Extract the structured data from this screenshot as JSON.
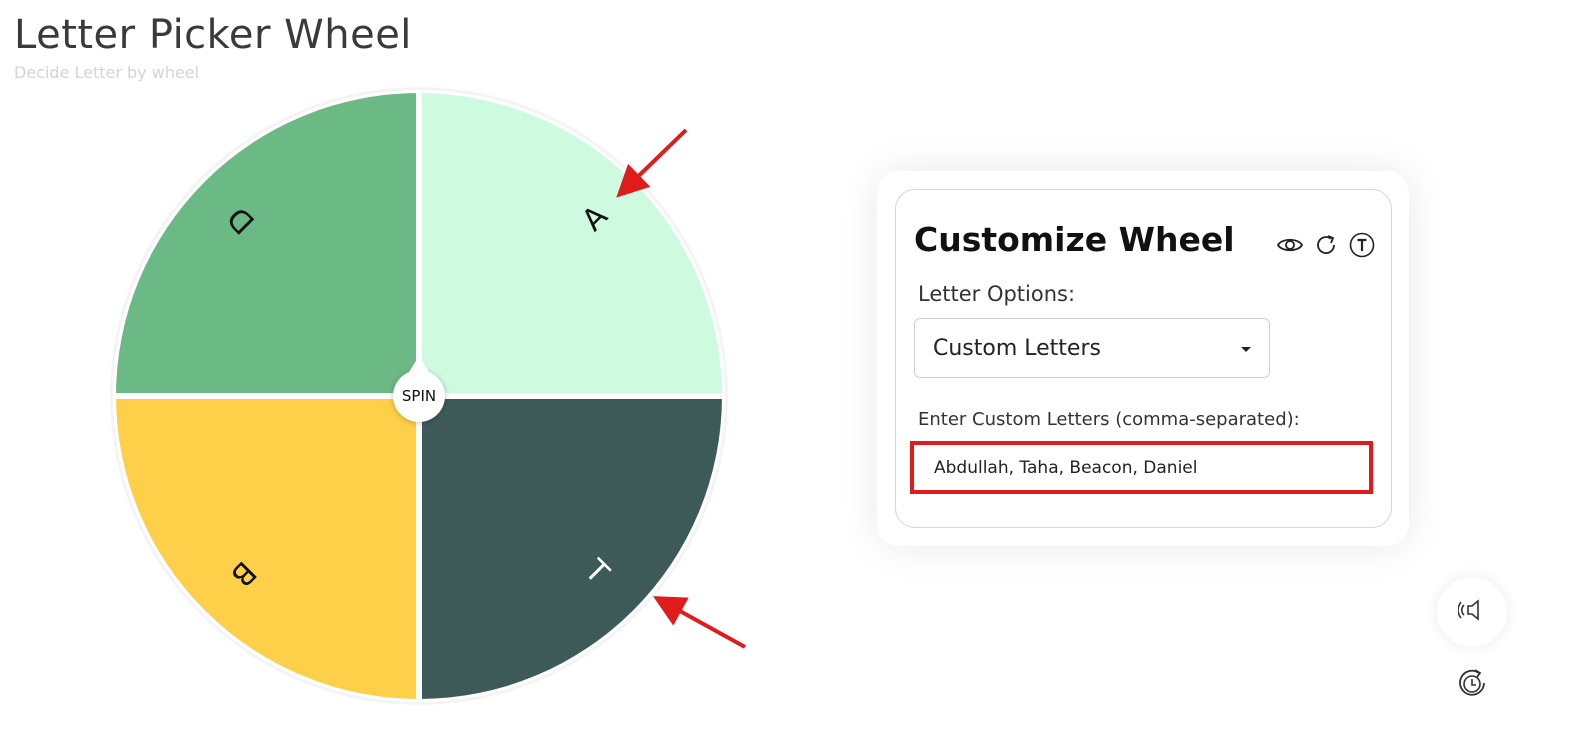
{
  "header": {
    "title": "Letter Picker Wheel",
    "subtitle": "Decide Letter by wheel"
  },
  "wheel": {
    "spin_label": "SPIN",
    "segments": [
      {
        "letter": "A",
        "color": "#cefadf",
        "text_color": "#111111"
      },
      {
        "letter": "T",
        "color": "#3e5a58",
        "text_color": "#ffffff"
      },
      {
        "letter": "B",
        "color": "#fed04a",
        "text_color": "#111111"
      },
      {
        "letter": "D",
        "color": "#6bb984",
        "text_color": "#111111"
      }
    ]
  },
  "panel": {
    "title": "Customize Wheel",
    "icons": [
      "eye-icon",
      "refresh-icon",
      "text-toggle-icon"
    ],
    "letter_options_label": "Letter Options:",
    "letter_options_selected": "Custom Letters",
    "custom_letters_label": "Enter Custom Letters (comma-separated):",
    "custom_letters_value": "Abdullah, Taha, Beacon, Daniel"
  },
  "floating_buttons": [
    "sound-icon",
    "history-icon"
  ],
  "colors": {
    "annotation_red": "#e01b1b"
  }
}
